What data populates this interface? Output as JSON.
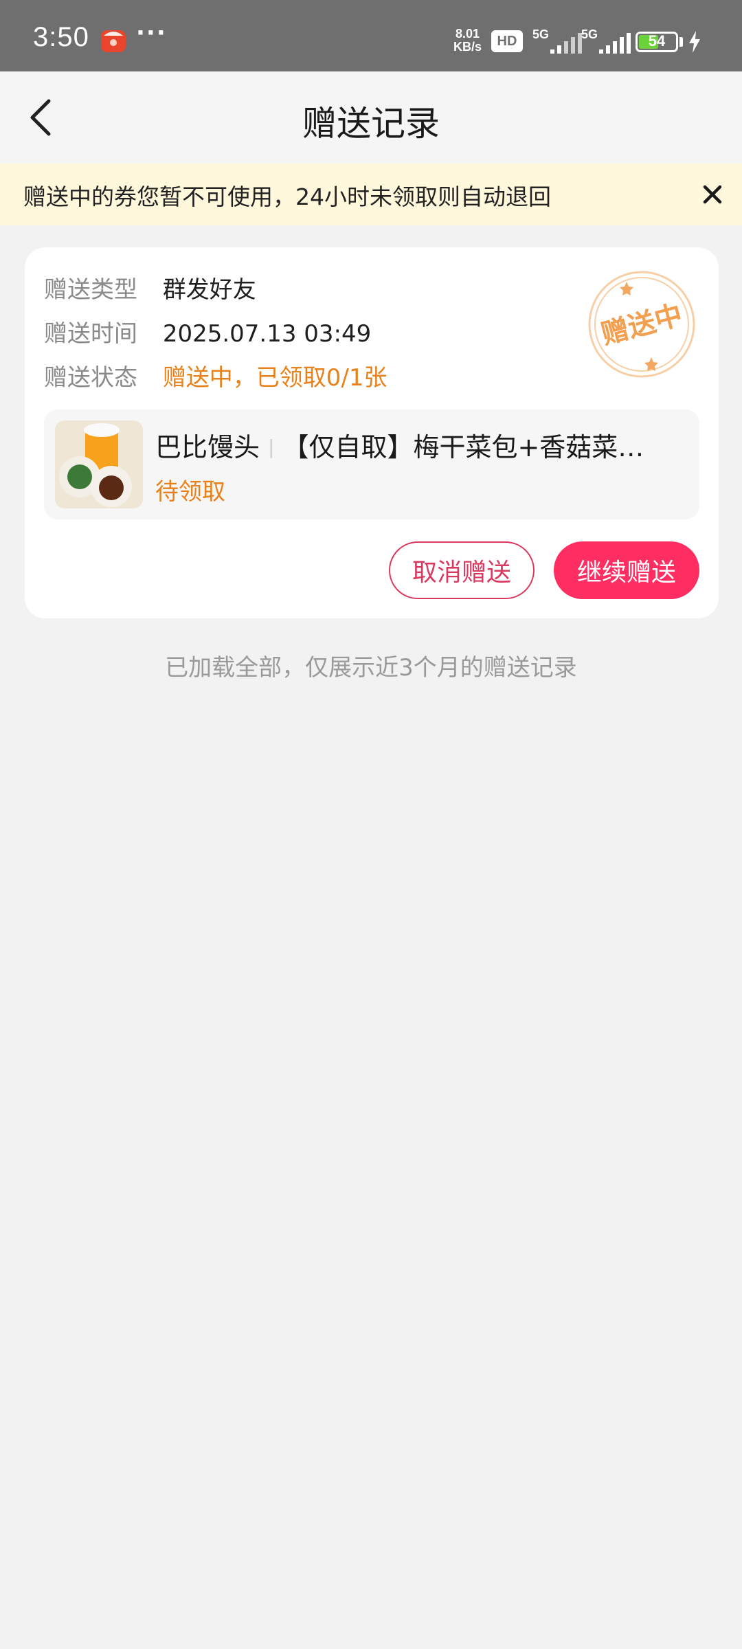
{
  "status_bar": {
    "time": "3:50",
    "dots": "···",
    "net_speed_value": "8.01",
    "net_speed_unit": "KB/s",
    "hd_label": "HD",
    "signal1_label": "5G",
    "signal2_label": "5G",
    "battery_level": "54",
    "battery_fraction": 0.54,
    "battery_color": "#6bd23c"
  },
  "nav": {
    "title": "赠送记录",
    "back_icon": "chevron-left-icon"
  },
  "notice": {
    "text": "赠送中的券您暂不可使用，24小时未领取则自动退回",
    "close_icon": "close-icon"
  },
  "record": {
    "type_label": "赠送类型",
    "type_value": "群发好友",
    "time_label": "赠送时间",
    "time_value": "2025.07.13 03:49",
    "status_label": "赠送状态",
    "status_value": "赠送中，已领取0/1张",
    "stamp_text": "赠送中",
    "product": {
      "brand": "巴比馒头",
      "separator": "|",
      "name": "【仅自取】梅干菜包+香菇菜…",
      "status": "待领取"
    },
    "cancel_label": "取消赠送",
    "continue_label": "继续赠送"
  },
  "footer": {
    "note": "已加载全部，仅展示近3个月的赠送记录"
  },
  "colors": {
    "accent_pink": "#ff2e62",
    "accent_orange": "#e8811a",
    "notice_bg": "#fff8dc"
  }
}
